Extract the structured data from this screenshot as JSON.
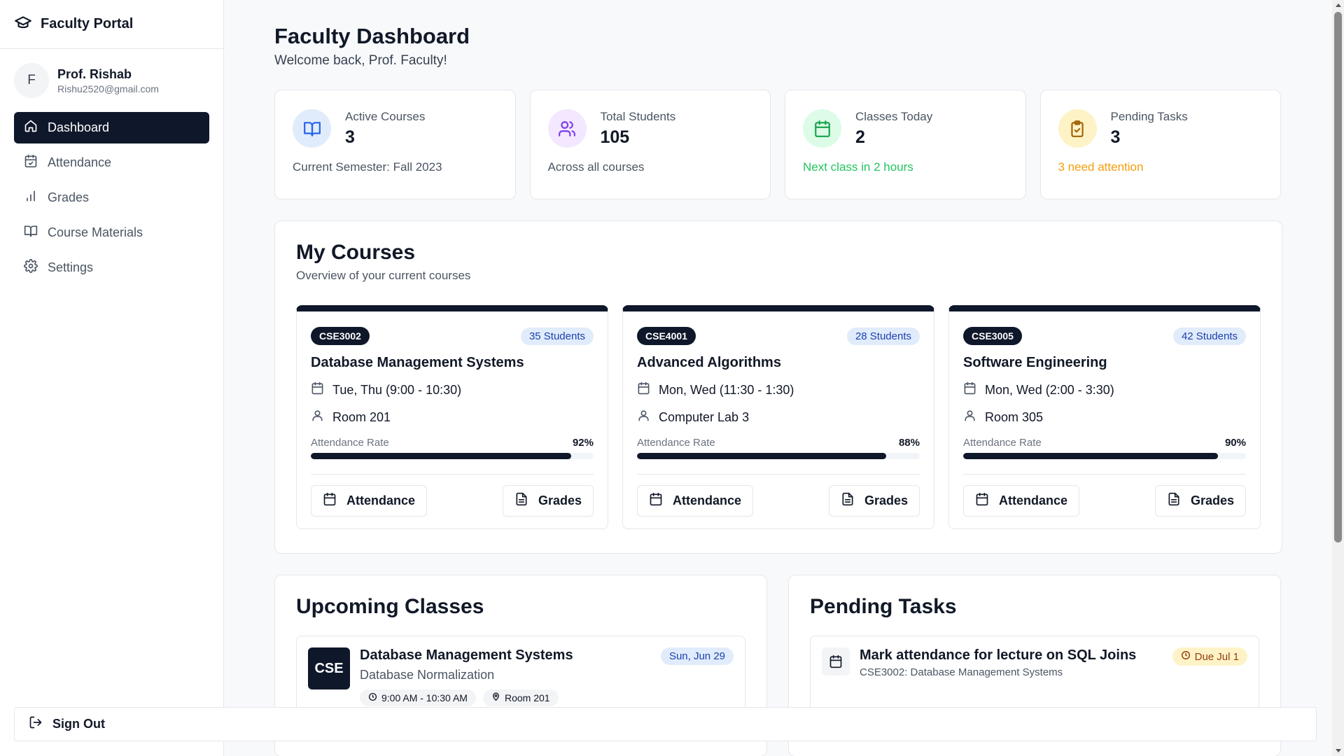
{
  "brand": {
    "title": "Faculty Portal",
    "icon": "graduation-cap-icon"
  },
  "profile": {
    "initial": "F",
    "name": "Prof. Rishab",
    "email": "Rishu2520@gmail.com"
  },
  "nav": [
    {
      "label": "Dashboard",
      "icon": "home-icon",
      "active": true
    },
    {
      "label": "Attendance",
      "icon": "calendar-check-icon"
    },
    {
      "label": "Grades",
      "icon": "bar-chart-icon"
    },
    {
      "label": "Course Materials",
      "icon": "book-open-icon"
    },
    {
      "label": "Settings",
      "icon": "gear-icon"
    }
  ],
  "header": {
    "title": "Faculty Dashboard",
    "subtitle": "Welcome back, Prof. Faculty!"
  },
  "stats": [
    {
      "label": "Active Courses",
      "value": "3",
      "foot": "Current Semester: Fall 2023",
      "icon": "book-icon",
      "color": "#2563eb",
      "bg": "#e0ecfb",
      "footColor": "#4b5563"
    },
    {
      "label": "Total Students",
      "value": "105",
      "foot": "Across all courses",
      "icon": "users-icon",
      "color": "#7c3aed",
      "bg": "#f3e8ff",
      "footColor": "#4b5563"
    },
    {
      "label": "Classes Today",
      "value": "2",
      "foot": "Next class in 2 hours",
      "icon": "calendar-icon",
      "color": "#16a34a",
      "bg": "#dcfce7",
      "footColor": "#22c55e"
    },
    {
      "label": "Pending Tasks",
      "value": "3",
      "foot": "3 need attention",
      "icon": "clipboard-check-icon",
      "color": "#a16207",
      "bg": "#fef3c7",
      "footColor": "#f59e0b"
    }
  ],
  "my_courses": {
    "title": "My Courses",
    "subtitle": "Overview of your current courses",
    "courses": [
      {
        "code": "CSE3002",
        "students": "35 Students",
        "name": "Database Management Systems",
        "schedule": "Tue, Thu (9:00 - 10:30)",
        "room": "Room 201",
        "attendance_label": "Attendance Rate",
        "attendance": "92%",
        "attendance_value": 92,
        "btn_attendance": "Attendance",
        "btn_grades": "Grades"
      },
      {
        "code": "CSE4001",
        "students": "28 Students",
        "name": "Advanced Algorithms",
        "schedule": "Mon, Wed (11:30 - 1:30)",
        "room": "Computer Lab 3",
        "attendance_label": "Attendance Rate",
        "attendance": "88%",
        "attendance_value": 88,
        "btn_attendance": "Attendance",
        "btn_grades": "Grades"
      },
      {
        "code": "CSE3005",
        "students": "42 Students",
        "name": "Software Engineering",
        "schedule": "Mon, Wed (2:00 - 3:30)",
        "room": "Room 305",
        "attendance_label": "Attendance Rate",
        "attendance": "90%",
        "attendance_value": 90,
        "btn_attendance": "Attendance",
        "btn_grades": "Grades"
      }
    ]
  },
  "upcoming": {
    "title": "Upcoming Classes",
    "items": [
      {
        "badge": "CSE",
        "title": "Database Management Systems",
        "topic": "Database Normalization",
        "date": "Sun, Jun 29",
        "time": "9:00 AM - 10:30 AM",
        "room": "Room 201"
      }
    ]
  },
  "tasks": {
    "title": "Pending Tasks",
    "items": [
      {
        "title": "Mark attendance for lecture on SQL Joins",
        "course": "CSE3002: Database Management Systems",
        "due": "Due Jul 1"
      }
    ]
  },
  "signout": {
    "label": "Sign Out"
  }
}
